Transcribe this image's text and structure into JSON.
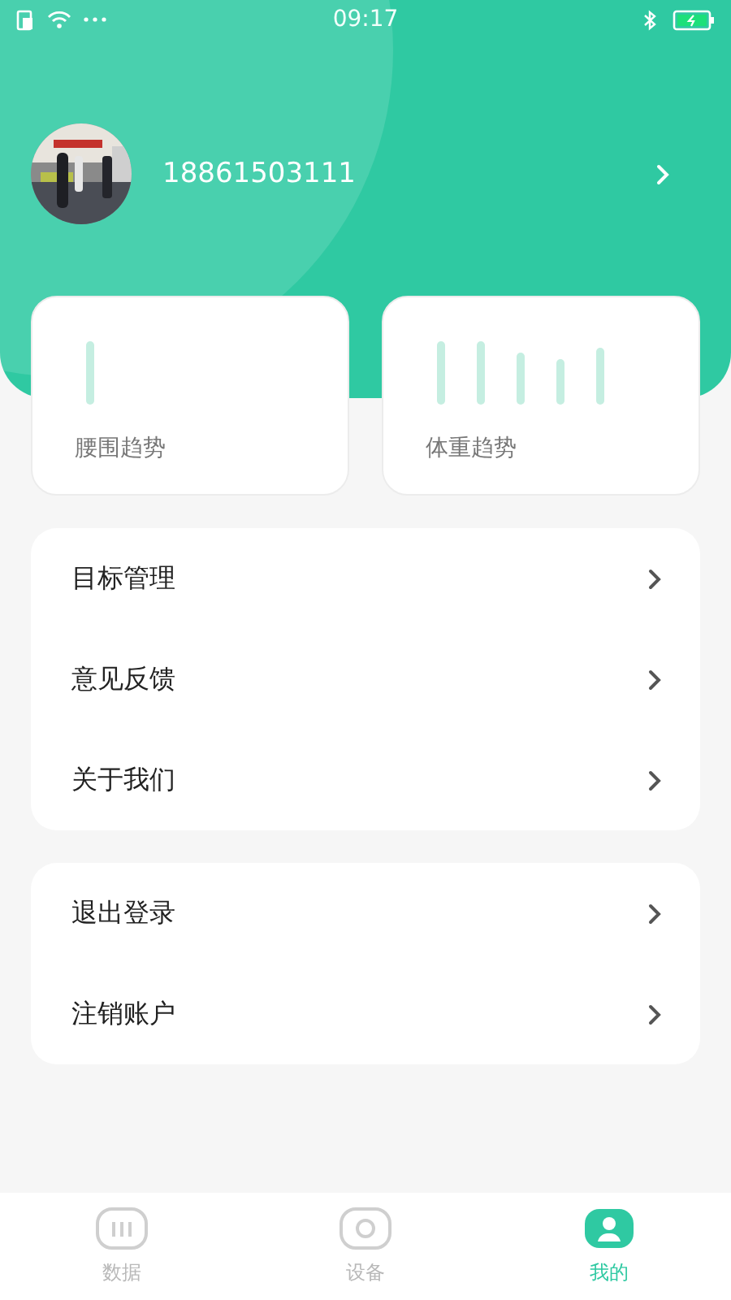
{
  "status_bar": {
    "time": "09:17"
  },
  "profile": {
    "phone": "18861503111"
  },
  "trend_cards": [
    {
      "label": "腰围趋势"
    },
    {
      "label": "体重趋势"
    }
  ],
  "menu_groups": [
    [
      {
        "label": "目标管理"
      },
      {
        "label": "意见反馈"
      },
      {
        "label": "关于我们"
      }
    ],
    [
      {
        "label": "退出登录"
      },
      {
        "label": "注销账户"
      }
    ]
  ],
  "bottom_nav": [
    {
      "label": "数据",
      "selected": false
    },
    {
      "label": "设备",
      "selected": false
    },
    {
      "label": "我的",
      "selected": true
    }
  ]
}
